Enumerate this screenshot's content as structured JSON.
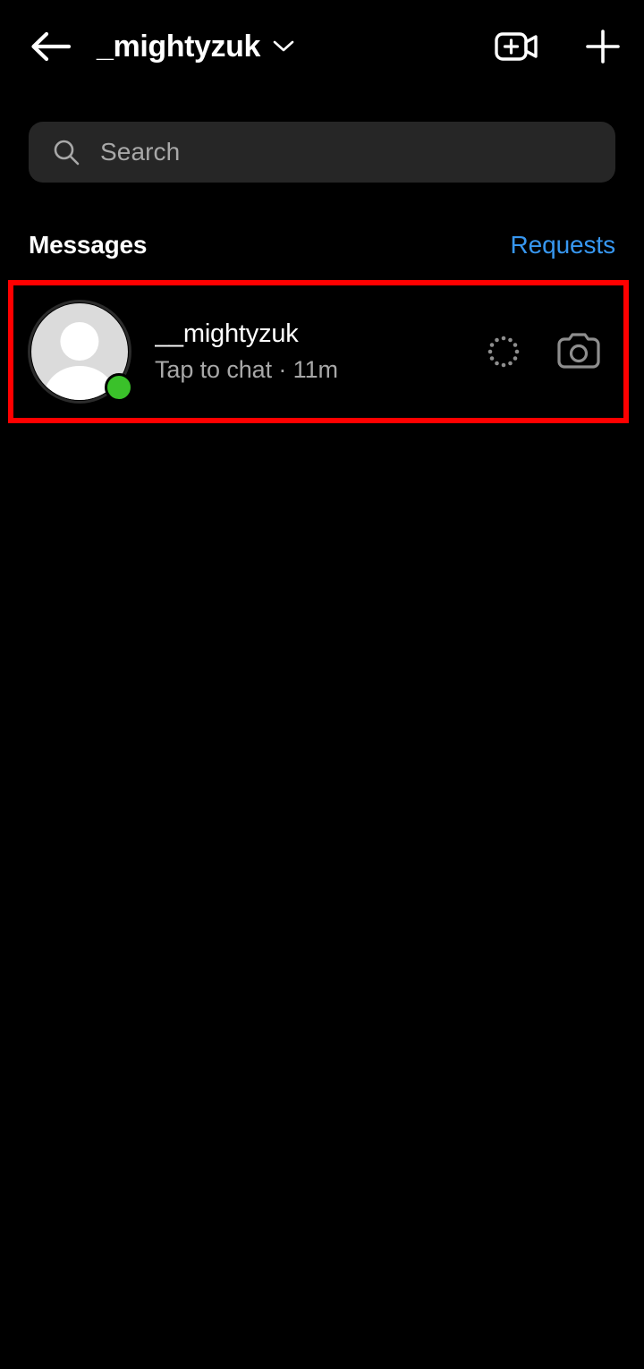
{
  "header": {
    "back_icon": "back-arrow-icon",
    "title": "_mightyzuk",
    "chevron_icon": "chevron-down-icon",
    "video_call_icon": "video-call-plus-icon",
    "new_message_icon": "plus-icon"
  },
  "search": {
    "icon": "search-icon",
    "placeholder": "Search",
    "value": "",
    "background": "#262626"
  },
  "section": {
    "title": "Messages",
    "action_label": "Requests",
    "action_color": "#3797f0"
  },
  "highlight": {
    "color": "#ff0000",
    "border_width_px": 6
  },
  "conversations": [
    {
      "username": "__mightyzuk",
      "subtitle": "Tap to chat · 11m",
      "status_text": "Tap to chat",
      "timestamp": "11m",
      "online": true,
      "online_color": "#3ac12a",
      "avatar_type": "default-person-placeholder",
      "note_icon": "dotted-circle-note-icon",
      "camera_icon": "camera-icon"
    }
  ],
  "theme": {
    "background": "#000000",
    "text_primary": "#ffffff",
    "text_secondary": "#a8a8a8"
  }
}
